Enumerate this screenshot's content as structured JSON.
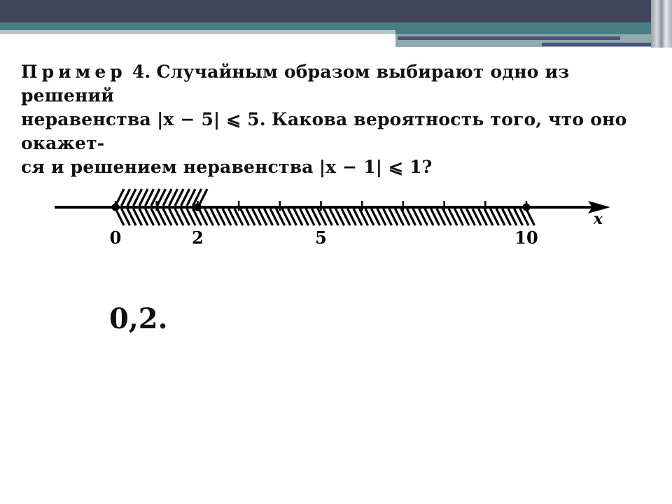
{
  "slide": {
    "header_colors": {
      "dark": "#43455a",
      "teal": "#467f84",
      "stripe": "#4b5280"
    }
  },
  "problem": {
    "label": "Пример",
    "number": "4.",
    "line1_rest": "Случайным образом выбирают одно из решений",
    "line2_pre": "неравенства",
    "ineq1": "|x − 5| ⩽ 5.",
    "line2_post": "Какова вероятность того, что оно окажет-",
    "line3_pre": "ся и решением неравенства",
    "ineq2": "|x − 1| ⩽ 1?"
  },
  "number_line": {
    "axis_label": "x",
    "range": [
      0,
      10
    ],
    "ticks": [
      0,
      1,
      2,
      3,
      4,
      5,
      6,
      7,
      8,
      9,
      10
    ],
    "tick_labels": [
      {
        "value": 0,
        "text": "0"
      },
      {
        "value": 2,
        "text": "2"
      },
      {
        "value": 5,
        "text": "5"
      },
      {
        "value": 10,
        "text": "10"
      }
    ],
    "upper_hatch": [
      0,
      2
    ],
    "lower_hatch": [
      0,
      10
    ],
    "closed_points": [
      0,
      2,
      10
    ]
  },
  "answer": "0,2."
}
